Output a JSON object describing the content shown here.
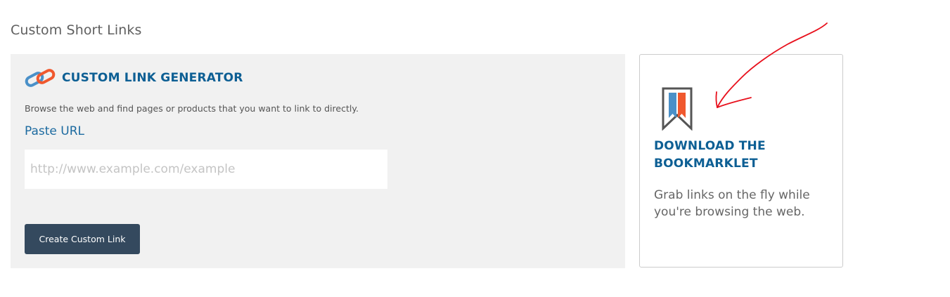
{
  "page": {
    "title": "Custom Short Links"
  },
  "generator": {
    "title": "CUSTOM LINK GENERATOR",
    "icon": "chain-link-icon",
    "description": "Browse the web and find pages or products that you want to link to directly.",
    "paste_label": "Paste URL",
    "url_input": {
      "value": "",
      "placeholder": "http://www.example.com/example"
    },
    "create_button_label": "Create Custom Link"
  },
  "bookmarklet": {
    "icon": "bookmark-icon",
    "title": "DOWNLOAD THE BOOKMARKLET",
    "description": "Grab links on the fly while you're browsing the web."
  },
  "annotation": {
    "icon": "red-hand-drawn-arrow"
  },
  "colors": {
    "accent_blue": "#0d5f94",
    "button_bg": "#34495e",
    "panel_bg": "#f1f1f1",
    "chain_blue": "#4a90c8",
    "chain_orange": "#f0582e",
    "annotation_red": "#e8101c"
  }
}
